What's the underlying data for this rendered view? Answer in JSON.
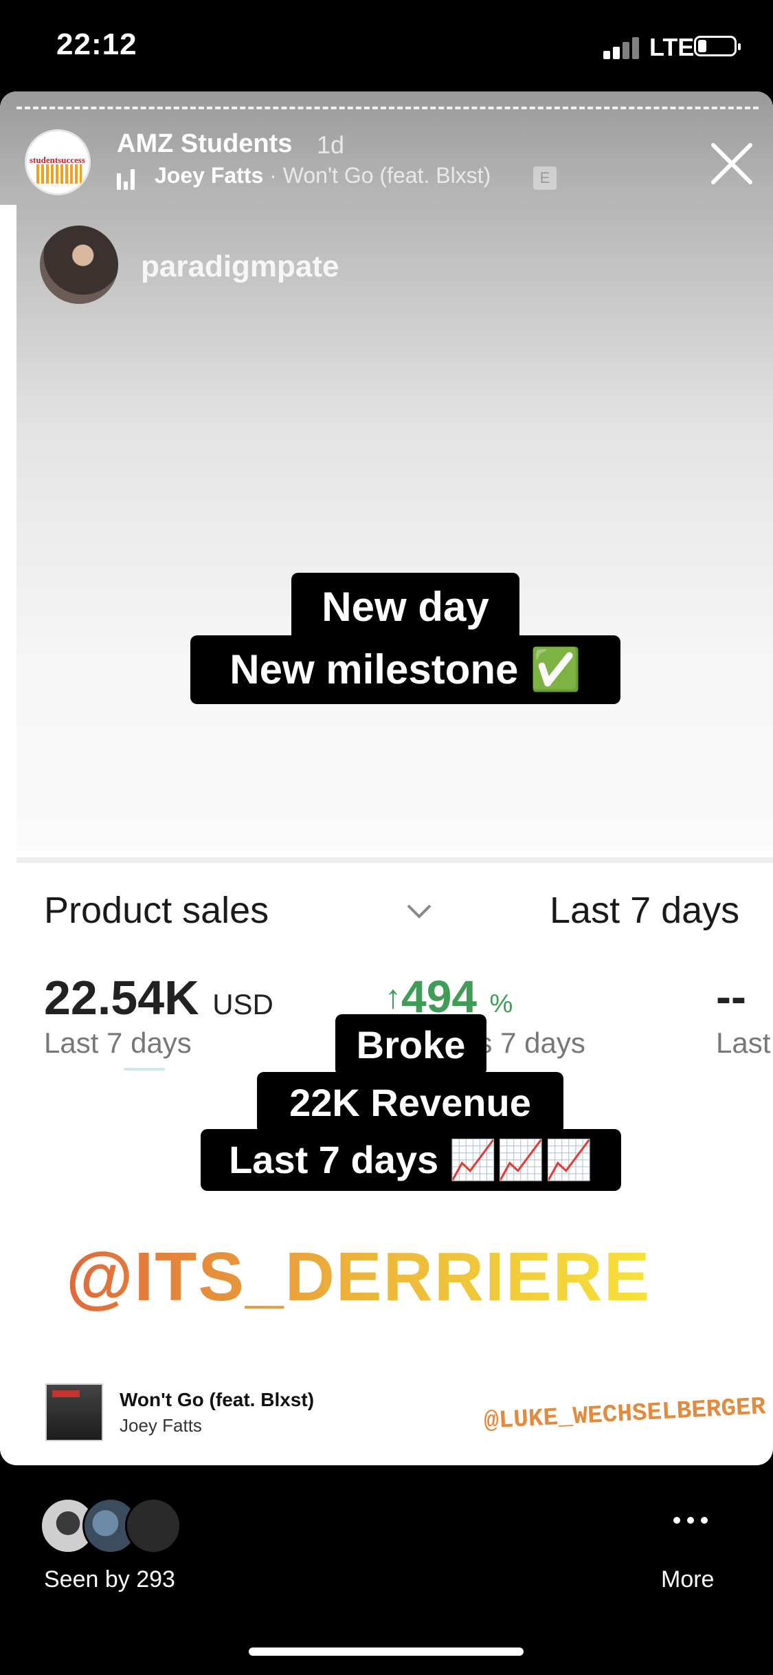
{
  "status_bar": {
    "time": "22:12",
    "network": "LTE"
  },
  "story": {
    "account": "AMZ Students",
    "age": "1d",
    "music": {
      "artist": "Joey Fatts",
      "separator": " · ",
      "title": "Won't Go (feat. Blxst)",
      "explicit_badge": "E"
    },
    "profile_name": "paradigmpate",
    "avatar_text": "studentsuccess"
  },
  "caption_top": [
    "New day",
    "New milestone ✅"
  ],
  "dashboard": {
    "metric_label": "Product sales",
    "range_label": "Last 7 days",
    "kpi_value": "22.54K",
    "kpi_unit": "USD",
    "kpi_sub": "Last 7 days",
    "growth_value": "494",
    "growth_unit": "%",
    "growth_sub": "Previous 7 days",
    "third_value": "--",
    "third_sub": "Last"
  },
  "caption_bottom": [
    "Broke",
    "22K Revenue",
    "Last 7 days 📈📈📈"
  ],
  "mention_large": "@ITS_DERRIERE",
  "music_sticker": {
    "title": "Won't Go (feat. Blxst)",
    "artist": "Joey Fatts"
  },
  "mention_small": "@LUKE_WECHSELBERGER",
  "footer": {
    "seen_by": "Seen by 293",
    "more_label": "More"
  }
}
